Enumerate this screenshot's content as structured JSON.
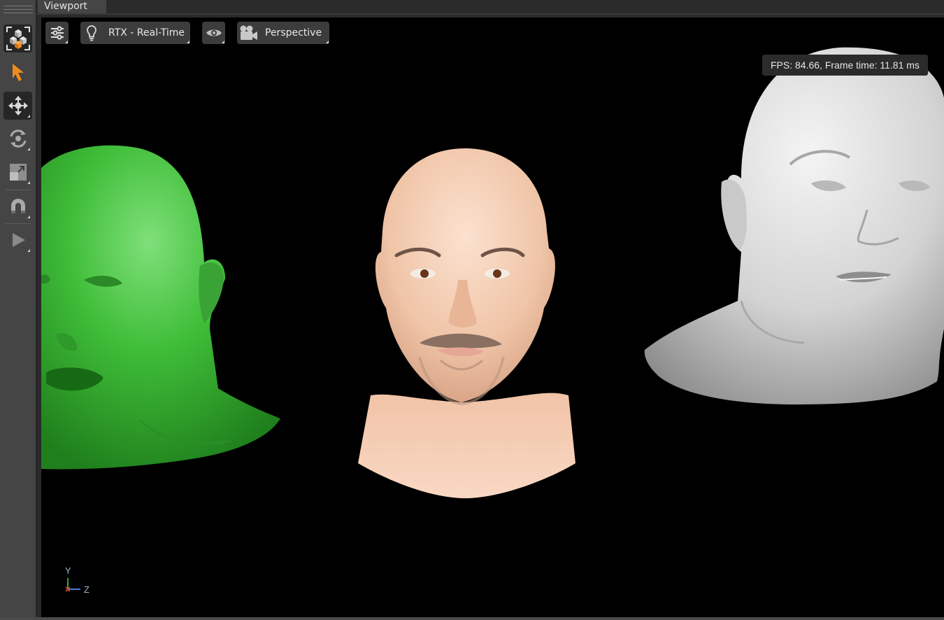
{
  "tab": {
    "title": "Viewport"
  },
  "toolbar": {
    "tools": [
      {
        "name": "select-mode-icon",
        "active": true
      },
      {
        "name": "select-arrow-icon",
        "active": false
      },
      {
        "name": "move-icon",
        "active": true
      },
      {
        "name": "rotate-icon",
        "active": false
      },
      {
        "name": "scale-icon",
        "active": false
      },
      {
        "name": "snap-magnet-icon",
        "active": false
      },
      {
        "name": "play-icon",
        "active": false
      }
    ]
  },
  "viewport": {
    "renderer_label": "RTX - Real-Time",
    "camera_label": "Perspective",
    "fps_text": "FPS: 84.66, Frame time: 11.81 ms",
    "axis": {
      "y": "Y",
      "z": "Z"
    }
  },
  "colors": {
    "accent_orange": "#f08c1f",
    "green_head": "#3ac03a",
    "skin_head": "#f2c9ad",
    "grey_head": "#d8d8d8"
  }
}
